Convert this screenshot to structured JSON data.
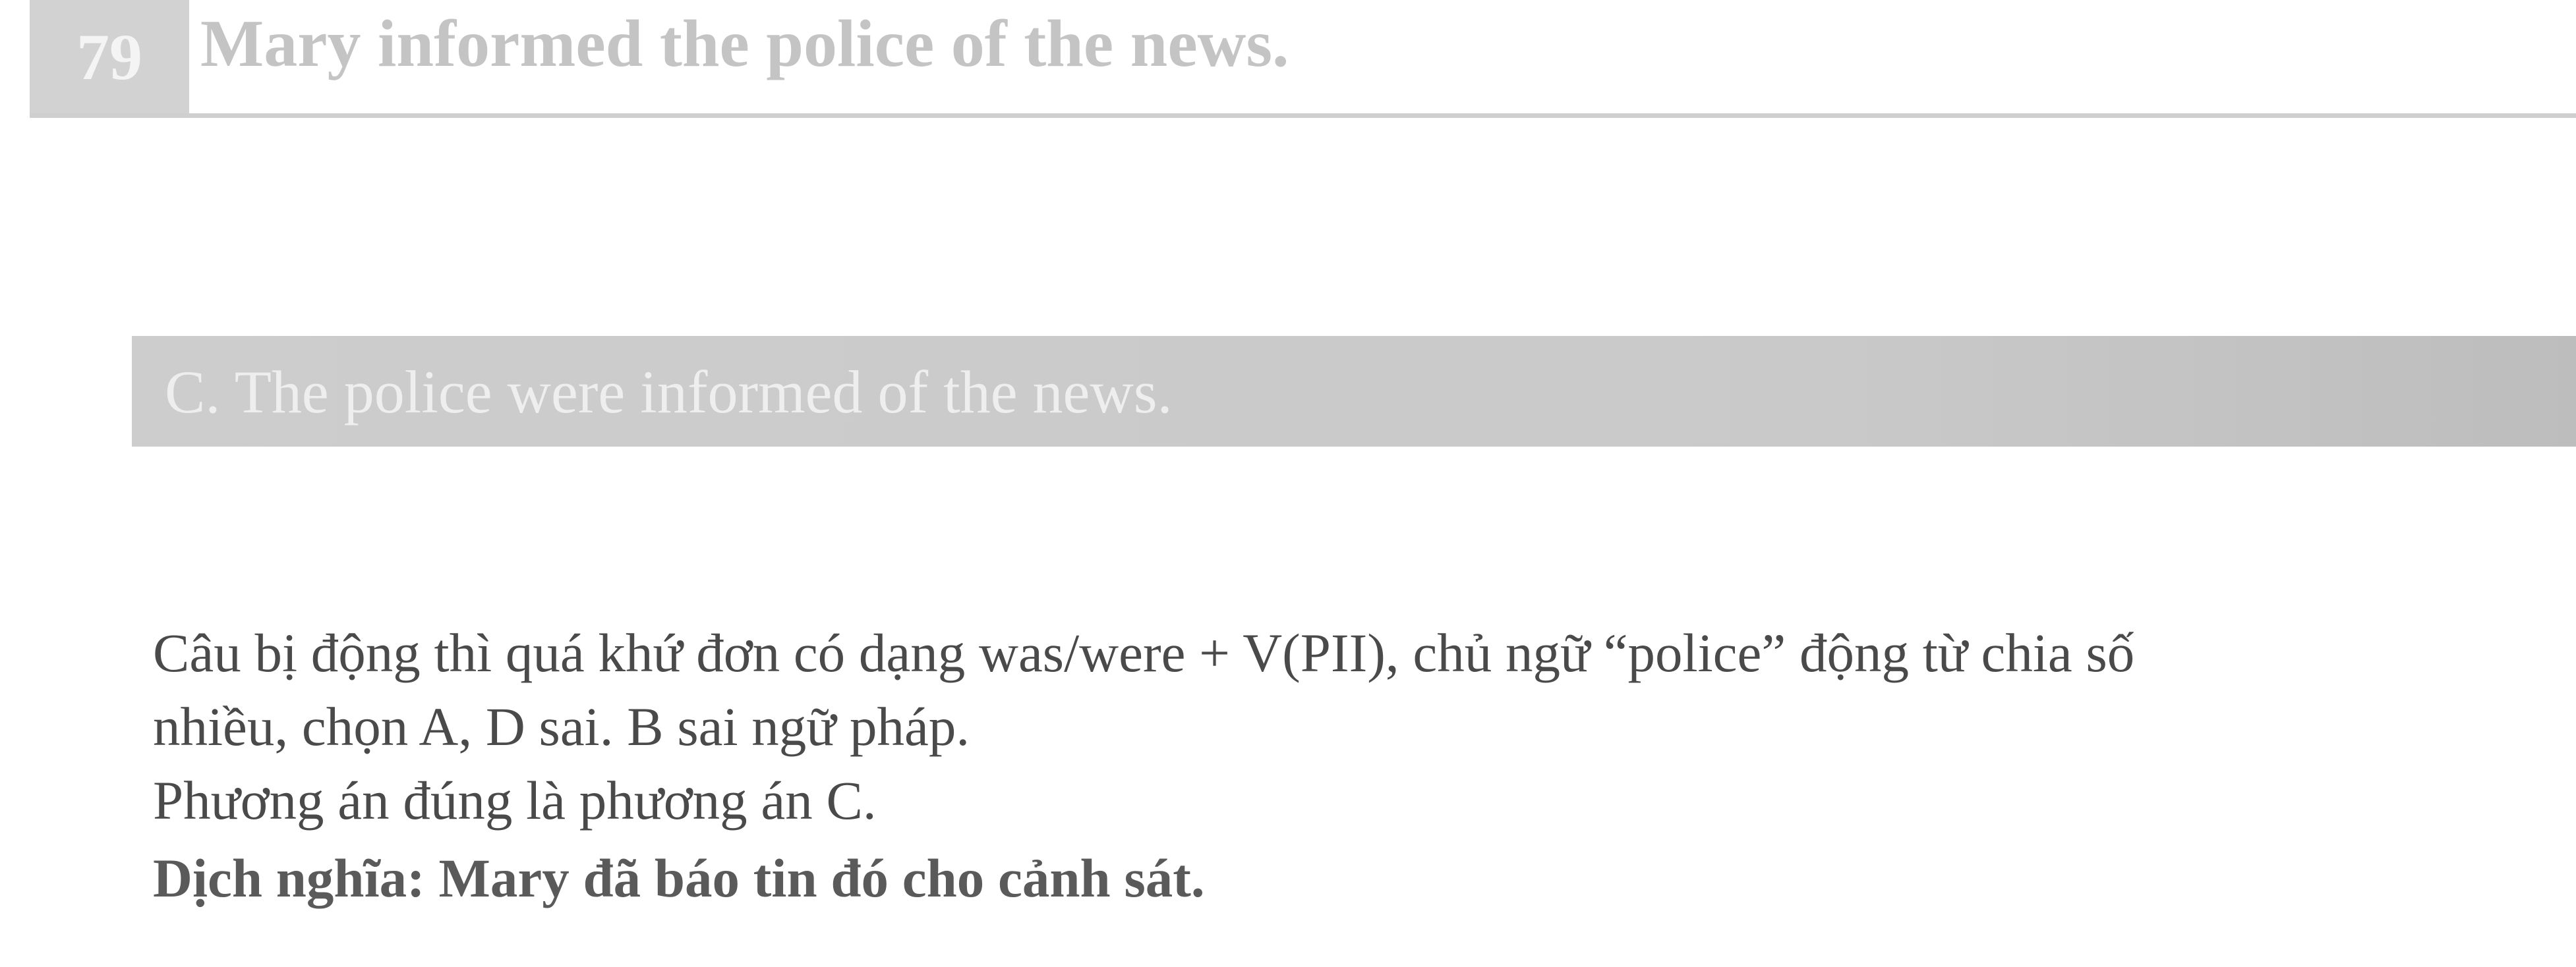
{
  "question": {
    "number": "79",
    "sentence": "Mary informed the police of the news."
  },
  "answer": {
    "text": "C. The police were informed of the news."
  },
  "explanation": {
    "lines": [
      "Câu bị động thì quá khứ đơn có dạng was/were + V(PII), chủ ngữ “police” động từ chia số",
      "nhiều, chọn A, D sai. B sai ngữ pháp.",
      "Phương án đúng là phương án C."
    ],
    "translation": "Dịch nghĩa: Mary đã báo tin đó cho cảnh sát."
  }
}
